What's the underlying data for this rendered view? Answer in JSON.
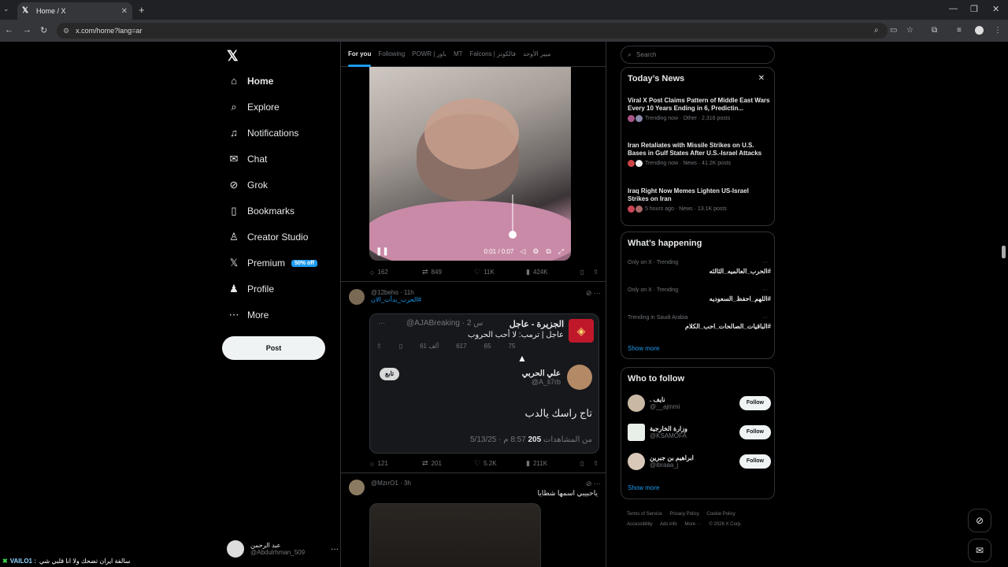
{
  "browser": {
    "tab_title": "Home / X",
    "url": "x.com/home?lang=ar"
  },
  "nav": {
    "items": [
      {
        "label": "Home",
        "icon": "home-icon"
      },
      {
        "label": "Explore",
        "icon": "search-icon"
      },
      {
        "label": "Notifications",
        "icon": "bell-icon"
      },
      {
        "label": "Chat",
        "icon": "mail-icon"
      },
      {
        "label": "Grok",
        "icon": "grok-icon"
      },
      {
        "label": "Bookmarks",
        "icon": "bookmark-icon"
      },
      {
        "label": "Creator Studio",
        "icon": "creator-icon"
      },
      {
        "label": "Premium",
        "icon": "x-icon"
      },
      {
        "label": "Profile",
        "icon": "person-icon"
      },
      {
        "label": "More",
        "icon": "more-icon"
      }
    ],
    "premium_badge": "50% off",
    "post_label": "Post",
    "account_name": "عبد الرحمن",
    "account_handle": "@Abdulrhman_509"
  },
  "feed": {
    "tabs": [
      "For you",
      "Following",
      "POWR | باور",
      "MT",
      "Falcons | فالكونز",
      "ميير الأوحد"
    ],
    "video": {
      "time": "0:01 / 0:07"
    },
    "tweet1_actions": {
      "replies": "162",
      "reposts": "849",
      "likes": "11K",
      "views": "424K"
    },
    "tweet2": {
      "handle": "@12beho · 11h",
      "text": "#الحرب_بدأت_الان",
      "quote": {
        "name": "الجزيرة - عاجل",
        "meta": "@AJABreaking · 2 س",
        "text": "عاجل | ترمب: لا أحب الحروب",
        "replies": "75",
        "reposts": "65",
        "likes": "617",
        "views": "61 ألف",
        "follow_label": "تابع",
        "reply_user_name": "علي الحربي",
        "reply_user_handle": "@A_li7rb",
        "reply_text": "تاج راسك يالدب",
        "reply_meta_date": "8:57 م · 5/13/25",
        "reply_meta_views": "205",
        "reply_meta_views_label": "من المشاهدات"
      },
      "actions": {
        "replies": "121",
        "reposts": "201",
        "likes": "5.2K",
        "views": "211K"
      }
    },
    "tweet3": {
      "handle": "@MzrrO1 · 3h",
      "text": "ياحبيبي اسمها شطايا"
    }
  },
  "right": {
    "search_placeholder": "Search",
    "news_title": "Today’s News",
    "news": [
      {
        "title": "Viral X Post Claims Pattern of Middle East Wars Every 10 Years Ending in 6, Predictin...",
        "meta": "Trending now · Other · 2,316 posts"
      },
      {
        "title": "Iran Retaliates with Missile Strikes on U.S. Bases in Gulf States After U.S.-Israel Attacks",
        "meta": "Trending now · News · 41.2K posts"
      },
      {
        "title": "Iraq Right Now Memes Lighten US-Israel Strikes on Iran",
        "meta": "5 hours ago · News · 13.1K posts"
      }
    ],
    "happening_title": "What’s happening",
    "trends": [
      {
        "context": "Only on X · Trending",
        "name": "#الحرب_العالميه_الثالثه"
      },
      {
        "context": "Only on X · Trending",
        "name": "#اللهم_احفظ_السعوديه"
      },
      {
        "context": "Trending in Saudi Arabia",
        "name": "#الباقيات_الصالحات_احب_الكلام"
      }
    ],
    "show_more": "Show more",
    "wtf_title": "Who to follow",
    "follows": [
      {
        "name": ". نايف",
        "handle": "@__ajmmi",
        "color": "#c9b9a4"
      },
      {
        "name": "وزارة الخارجية",
        "handle": "@KSAMOFA",
        "color": "#e8efe9"
      },
      {
        "name": "ابراهيم بن جبرين",
        "handle": "@ibraaa_j",
        "color": "#d9c8b8"
      }
    ],
    "follow_label": "Follow",
    "footer": [
      "Terms of Service",
      "Privacy Policy",
      "Cookie Policy",
      "Accessibility",
      "Ads info",
      "More ···",
      "© 2026 X Corp."
    ]
  },
  "ticker": {
    "label": "VAILO1 :",
    "text": "سالفة ايران تضحك ولا انا قلبي شي"
  }
}
